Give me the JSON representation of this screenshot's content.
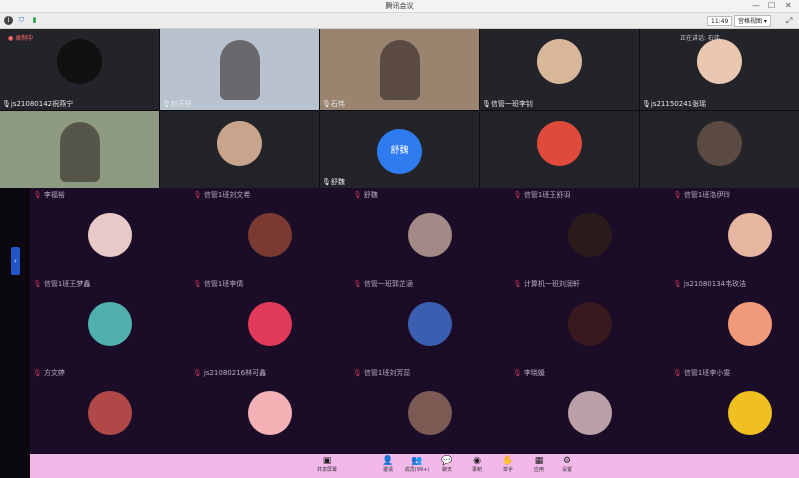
{
  "window": {
    "title": "腾讯会议"
  },
  "infobar": {
    "clock": "11:49",
    "view_label": "宫格视图",
    "fullscreen_icon": "fullscreen-icon"
  },
  "top_status": {
    "recording": "录制中",
    "speaking": "正在讲话: 石伟"
  },
  "video_tiles": [
    {
      "name": "js21080142祝燕宁",
      "type": "avatar",
      "avatar_color": "#111111"
    },
    {
      "name": "赵天舒",
      "type": "camera",
      "bg": "#b9c3cf"
    },
    {
      "name": "石伟",
      "type": "camera",
      "bg": "#9a8470"
    },
    {
      "name": "信管一班李钊",
      "type": "avatar",
      "avatar_color": "#d9b79a"
    },
    {
      "name": "js21150241张瑶",
      "type": "avatar",
      "avatar_color": "#e9c7b0"
    }
  ],
  "row2_tiles": [
    {
      "name": "",
      "type": "camera",
      "bg": "#8f9a82"
    },
    {
      "name": "",
      "type": "avatar",
      "avatar_color": "#c9a48c"
    },
    {
      "name": "舒魏",
      "type": "initial",
      "initial": "舒魏",
      "avatar_color": "#2f7bf0"
    },
    {
      "name": "",
      "type": "avatar",
      "avatar_color": "#e04a3a"
    },
    {
      "name": "",
      "type": "avatar",
      "avatar_color": "#5a4a42"
    }
  ],
  "gallery": [
    {
      "name": "李福裕",
      "avatar_color": "#e9c9c8"
    },
    {
      "name": "信管1班刘文希",
      "avatar_color": "#7a3a32"
    },
    {
      "name": "舒魏",
      "avatar_color": "#a48a86"
    },
    {
      "name": "信管1班王舒羽",
      "avatar_color": "#2a1a1a"
    },
    {
      "name": "信管1班洛伊玲",
      "avatar_color": "#e7b6a0"
    },
    {
      "name": "信管1班王梦鑫",
      "avatar_color": "#4fb0ad"
    },
    {
      "name": "信管1班李倩",
      "avatar_color": "#e03a58"
    },
    {
      "name": "信管一班郭芷涵",
      "avatar_color": "#3a5fb0"
    },
    {
      "name": "计算机一班刘润轩",
      "avatar_color": "#3a1820"
    },
    {
      "name": "js21080134韦玫洁",
      "avatar_color": "#f09a7a"
    },
    {
      "name": "方文婷",
      "avatar_color": "#b04848"
    },
    {
      "name": "js21080216林可鑫",
      "avatar_color": "#f3b0b5"
    },
    {
      "name": "信管1班刘芳蕊",
      "avatar_color": "#7a5a52"
    },
    {
      "name": "李晓媛",
      "avatar_color": "#bca0a8"
    },
    {
      "name": "信管1班李小雯",
      "avatar_color": "#f0c020"
    }
  ],
  "toolbar": [
    {
      "label": "共享屏幕",
      "icon": "share-screen-icon"
    },
    {
      "label": "邀请",
      "icon": "invite-icon"
    },
    {
      "label": "成员(99+)",
      "icon": "members-icon"
    },
    {
      "label": "聊天",
      "icon": "chat-icon"
    },
    {
      "label": "录制",
      "icon": "record-icon"
    },
    {
      "label": "举手",
      "icon": "raise-hand-icon"
    },
    {
      "label": "应用",
      "icon": "apps-icon"
    },
    {
      "label": "设置",
      "icon": "settings-icon"
    }
  ]
}
